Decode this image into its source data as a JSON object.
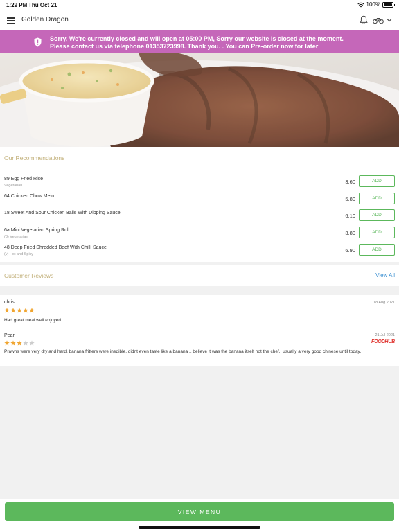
{
  "status_bar": {
    "time": "1:29 PM",
    "date": "Thu Oct 21",
    "battery": "100%",
    "battery_level": 1.0
  },
  "header": {
    "title": "Golden Dragon",
    "icons": [
      "menu-icon",
      "bell-icon",
      "bike-icon",
      "chevron-down-icon"
    ]
  },
  "banner": {
    "line1": "Sorry, We're currently closed and will open at 05:00 PM, Sorry our website is closed at the moment.",
    "line2": "Please contact us via telephone 01353723998. Thank you. . You can Pre-order now for later",
    "color": "#c567b9"
  },
  "recommendations": {
    "title": "Our Recommendations",
    "add_label": "ADD",
    "items": [
      {
        "name": "89 Egg Fried Rice",
        "sub": "Vegetarian",
        "price": "3.60"
      },
      {
        "name": "64 Chicken Chow Mein",
        "sub": "",
        "price": "5.80"
      },
      {
        "name": "18 Sweet And Sour Chicken Balls With Dipping Sauce",
        "sub": "",
        "price": "6.10"
      },
      {
        "name": "6a Mini Vegetarian Spring Roll",
        "sub": "(8) Vegetarian",
        "price": "3.80"
      },
      {
        "name": "48 Deep Fried Shredded Beef With Chilli Sauce",
        "sub": "(v) Hot and Spicy",
        "price": "6.90"
      }
    ]
  },
  "reviews": {
    "title": "Customer Reviews",
    "view_all": "View All",
    "items": [
      {
        "author": "chris",
        "date": "18 Aug 2021",
        "rating": 5,
        "text": "Had great meal well enjoyed",
        "source": ""
      },
      {
        "author": "Pearl",
        "date": "21 Jul 2021",
        "rating": 3,
        "text": "Prawns were very dry and hard, banana fritters were inedible, didnt even taste like a banana .. believe it was the banana itself not the chef.. usually a very good chinese until today.",
        "source": "FOODHUB"
      }
    ]
  },
  "bottom": {
    "view_menu": "VIEW MENU"
  },
  "colors": {
    "accent_green": "#5cb85c",
    "section_title": "#c2b07a",
    "link_blue": "#3a8fd1",
    "star_gold": "#f0a530",
    "star_empty": "#cccccc"
  }
}
